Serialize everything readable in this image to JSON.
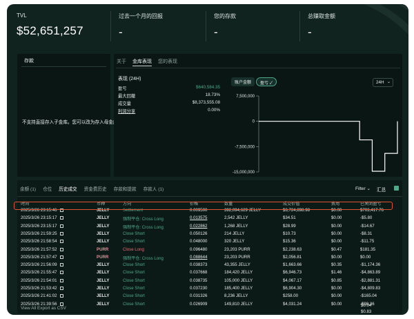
{
  "stats": {
    "tvl_label": "TVL",
    "tvl_value": "$52,651,257",
    "return_label": "过去一个月的回报",
    "return_value": "-",
    "deposit_label": "您的存款",
    "deposit_value": "-",
    "earn_label": "总赚取金额",
    "earn_value": "-"
  },
  "deposit_panel": {
    "tab": "存款",
    "message": "不支持直接存入子金库。您可以改为存入母金库。"
  },
  "vault_tabs": [
    "关于",
    "金库表现",
    "您的表现"
  ],
  "performance": {
    "title": "表现 (24H)",
    "rows": [
      {
        "label": "盈亏",
        "value": "$640,584.35"
      },
      {
        "label": "最大回撤",
        "value": "18.73%"
      },
      {
        "label": "成交量",
        "value": "$8,373,555.08"
      },
      {
        "label": "利润分享",
        "value": "0.00%"
      }
    ]
  },
  "chart_controls": {
    "account_value": "账户金额",
    "pnl": "盈亏",
    "range": "24H"
  },
  "chart_data": {
    "type": "line",
    "yticks": [
      "7,500,000",
      "0",
      "-7,500,000",
      "-15,000,000"
    ],
    "ylim": [
      -15000000,
      7500000
    ],
    "x": [
      0,
      1,
      2,
      3,
      4,
      5,
      6,
      7,
      8,
      9,
      10,
      11
    ],
    "series": [
      {
        "values": [
          0,
          0,
          0,
          0,
          0,
          0,
          0,
          0,
          -5500000,
          -14800000,
          -9500000,
          0
        ]
      }
    ],
    "color": "#ffffff"
  },
  "history": {
    "tabs": [
      "余额 (1)",
      "仓位",
      "历史成交",
      "资金费历史",
      "存款和提款",
      "存款人 (1)"
    ],
    "filter": "Filter",
    "summary_label": "汇总",
    "columns": [
      "时间",
      "币种",
      "方向",
      "价格",
      "数量",
      "成交价值",
      "费用",
      "已关闭盈亏"
    ],
    "rows": [
      {
        "time": "2025/3/26 23:15:46",
        "coin": "JELLY",
        "dir": "Settlement",
        "price": "0.009500",
        "qty": "392,094,629 JELLY",
        "value": "$3,724,898.98",
        "fee": "$0.00",
        "pnl": "$703,417.76"
      },
      {
        "time": "2025/3/26 23:15:17",
        "coin": "JELLY",
        "dir": "强制平仓: Cross Long",
        "price": "0.013575",
        "qty": "2,542 JELLY",
        "value": "$34.51",
        "fee": "$0.00",
        "pnl": "-$5.80"
      },
      {
        "time": "2025/3/26 23:15:17",
        "coin": "JELLY",
        "dir": "强制平仓: Cross Long",
        "price": "0.022862",
        "qty": "1,268 JELLY",
        "value": "$28.99",
        "fee": "$0.00",
        "pnl": "-$14.67"
      },
      {
        "time": "2025/3/26 21:59:25",
        "coin": "JELLY",
        "dir": "Close Short",
        "price": "0.050126",
        "qty": "214 JELLY",
        "value": "$10.73",
        "fee": "$0.00",
        "pnl": "-$8.31"
      },
      {
        "time": "2025/3/26 21:58:54",
        "coin": "JELLY",
        "dir": "Close Short",
        "price": "0.048000",
        "qty": "320 JELLY",
        "value": "$15.36",
        "fee": "$0.00",
        "pnl": "-$11.75"
      },
      {
        "time": "2025/3/26 21:57:52",
        "coin": "PURR",
        "dir": "Close Long",
        "price": "0.096480",
        "qty": "23,203 PURR",
        "value": "$2,238.63",
        "fee": "$0.47",
        "pnl": "$181.35"
      },
      {
        "time": "2025/3/26 21:57:47",
        "coin": "PURR",
        "dir": "强制平仓: Cross Long",
        "price": "0.088644",
        "qty": "23,203 PURR",
        "value": "$2,056.81",
        "fee": "$0.00",
        "pnl": "$0.00"
      },
      {
        "time": "2025/3/26 21:56:09",
        "coin": "JELLY",
        "dir": "Close Short",
        "price": "0.038373",
        "qty": "43,355 JELLY",
        "value": "$1,663.66",
        "fee": "$0.35",
        "pnl": "-$1,174.36"
      },
      {
        "time": "2025/3/26 21:55:47",
        "coin": "JELLY",
        "dir": "Close Short",
        "price": "0.037668",
        "qty": "184,420 JELLY",
        "value": "$6,946.73",
        "fee": "$1.46",
        "pnl": "-$4,863.89"
      },
      {
        "time": "2025/3/26 21:54:01",
        "coin": "JELLY",
        "dir": "Close Short",
        "price": "0.038735",
        "qty": "105,000 JELLY",
        "value": "$4,067.17",
        "fee": "$0.85",
        "pnl": "-$2,881.31"
      },
      {
        "time": "2025/3/26 21:53:42",
        "coin": "JELLY",
        "dir": "Close Short",
        "price": "0.037230",
        "qty": "185,400 JELLY",
        "value": "$6,904.30",
        "fee": "$0.00",
        "pnl": "-$4,809.83"
      },
      {
        "time": "2025/3/26 21:41:02",
        "coin": "JELLY",
        "dir": "Close Short",
        "price": "0.031326",
        "qty": "8,236 JELLY",
        "value": "$258.00",
        "fee": "$0.00",
        "pnl": "-$165.04"
      },
      {
        "time": "2025/3/26 21:39:56",
        "coin": "JELLY",
        "dir": "Close Short",
        "price": "0.026909",
        "qty": "149,810 JELLY",
        "value": "$4,031.24",
        "fee": "$0.00",
        "pnl": "-$98.36"
      }
    ],
    "footer": "View All   Export as CSV",
    "overflow_fees": [
      "$0.04",
      "$0.83",
      "$0.00",
      "$0.04"
    ]
  }
}
